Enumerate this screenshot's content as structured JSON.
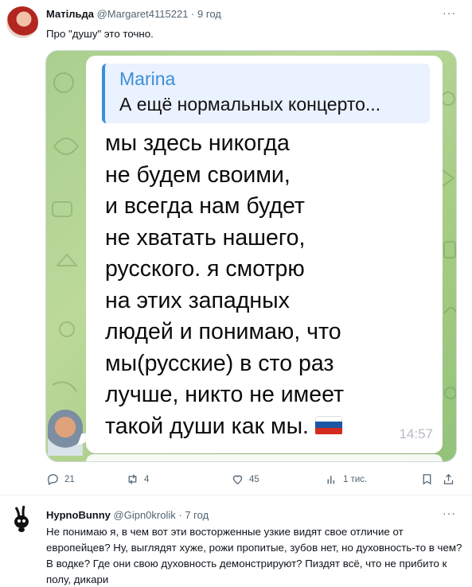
{
  "tweets": [
    {
      "author_name": "Матільда",
      "handle": "@Margaret4115221",
      "separator": "·",
      "time": "9 год",
      "more": "···",
      "text": "Про \"душу\" это точно.",
      "media": {
        "quote_author": "Marina",
        "quote_text": "А ещё нормальных концерто...",
        "message": "мы здесь никогда\nне будем своими,\nи всегда нам будет\nне хватать нашего,\nрусского. я смотрю\nна этих западных\nлюдей и понимаю, что\nмы(русские) в сто раз\nлучше, никто не имеет\nтакой души как мы.",
        "flag_colors": [
          "#ffffff",
          "#1c57a5",
          "#d52b1e"
        ],
        "message_time": "14:57"
      },
      "actions": {
        "reply_count": "21",
        "retweet_count": "4",
        "like_count": "45",
        "views_count": "1 тис."
      }
    },
    {
      "author_name": "HypnoBunny",
      "handle": "@Gipn0krolik",
      "separator": "·",
      "time": "7 год",
      "more": "···",
      "text": "Не понимаю я, в чем вот эти восторженные узкие видят свое отличие от европейцев? Ну, выглядят хуже, рожи пропитые, зубов нет, но духовность-то в чем? В водке? Где они свою духовность демонстрируют? Пиздят всё, что не прибито к полу, дикари"
    }
  ],
  "colors": {
    "text_primary": "#0f1419",
    "text_secondary": "#536471",
    "quote_accent": "#3b8fd8",
    "chat_background": "#a9cf8e"
  }
}
